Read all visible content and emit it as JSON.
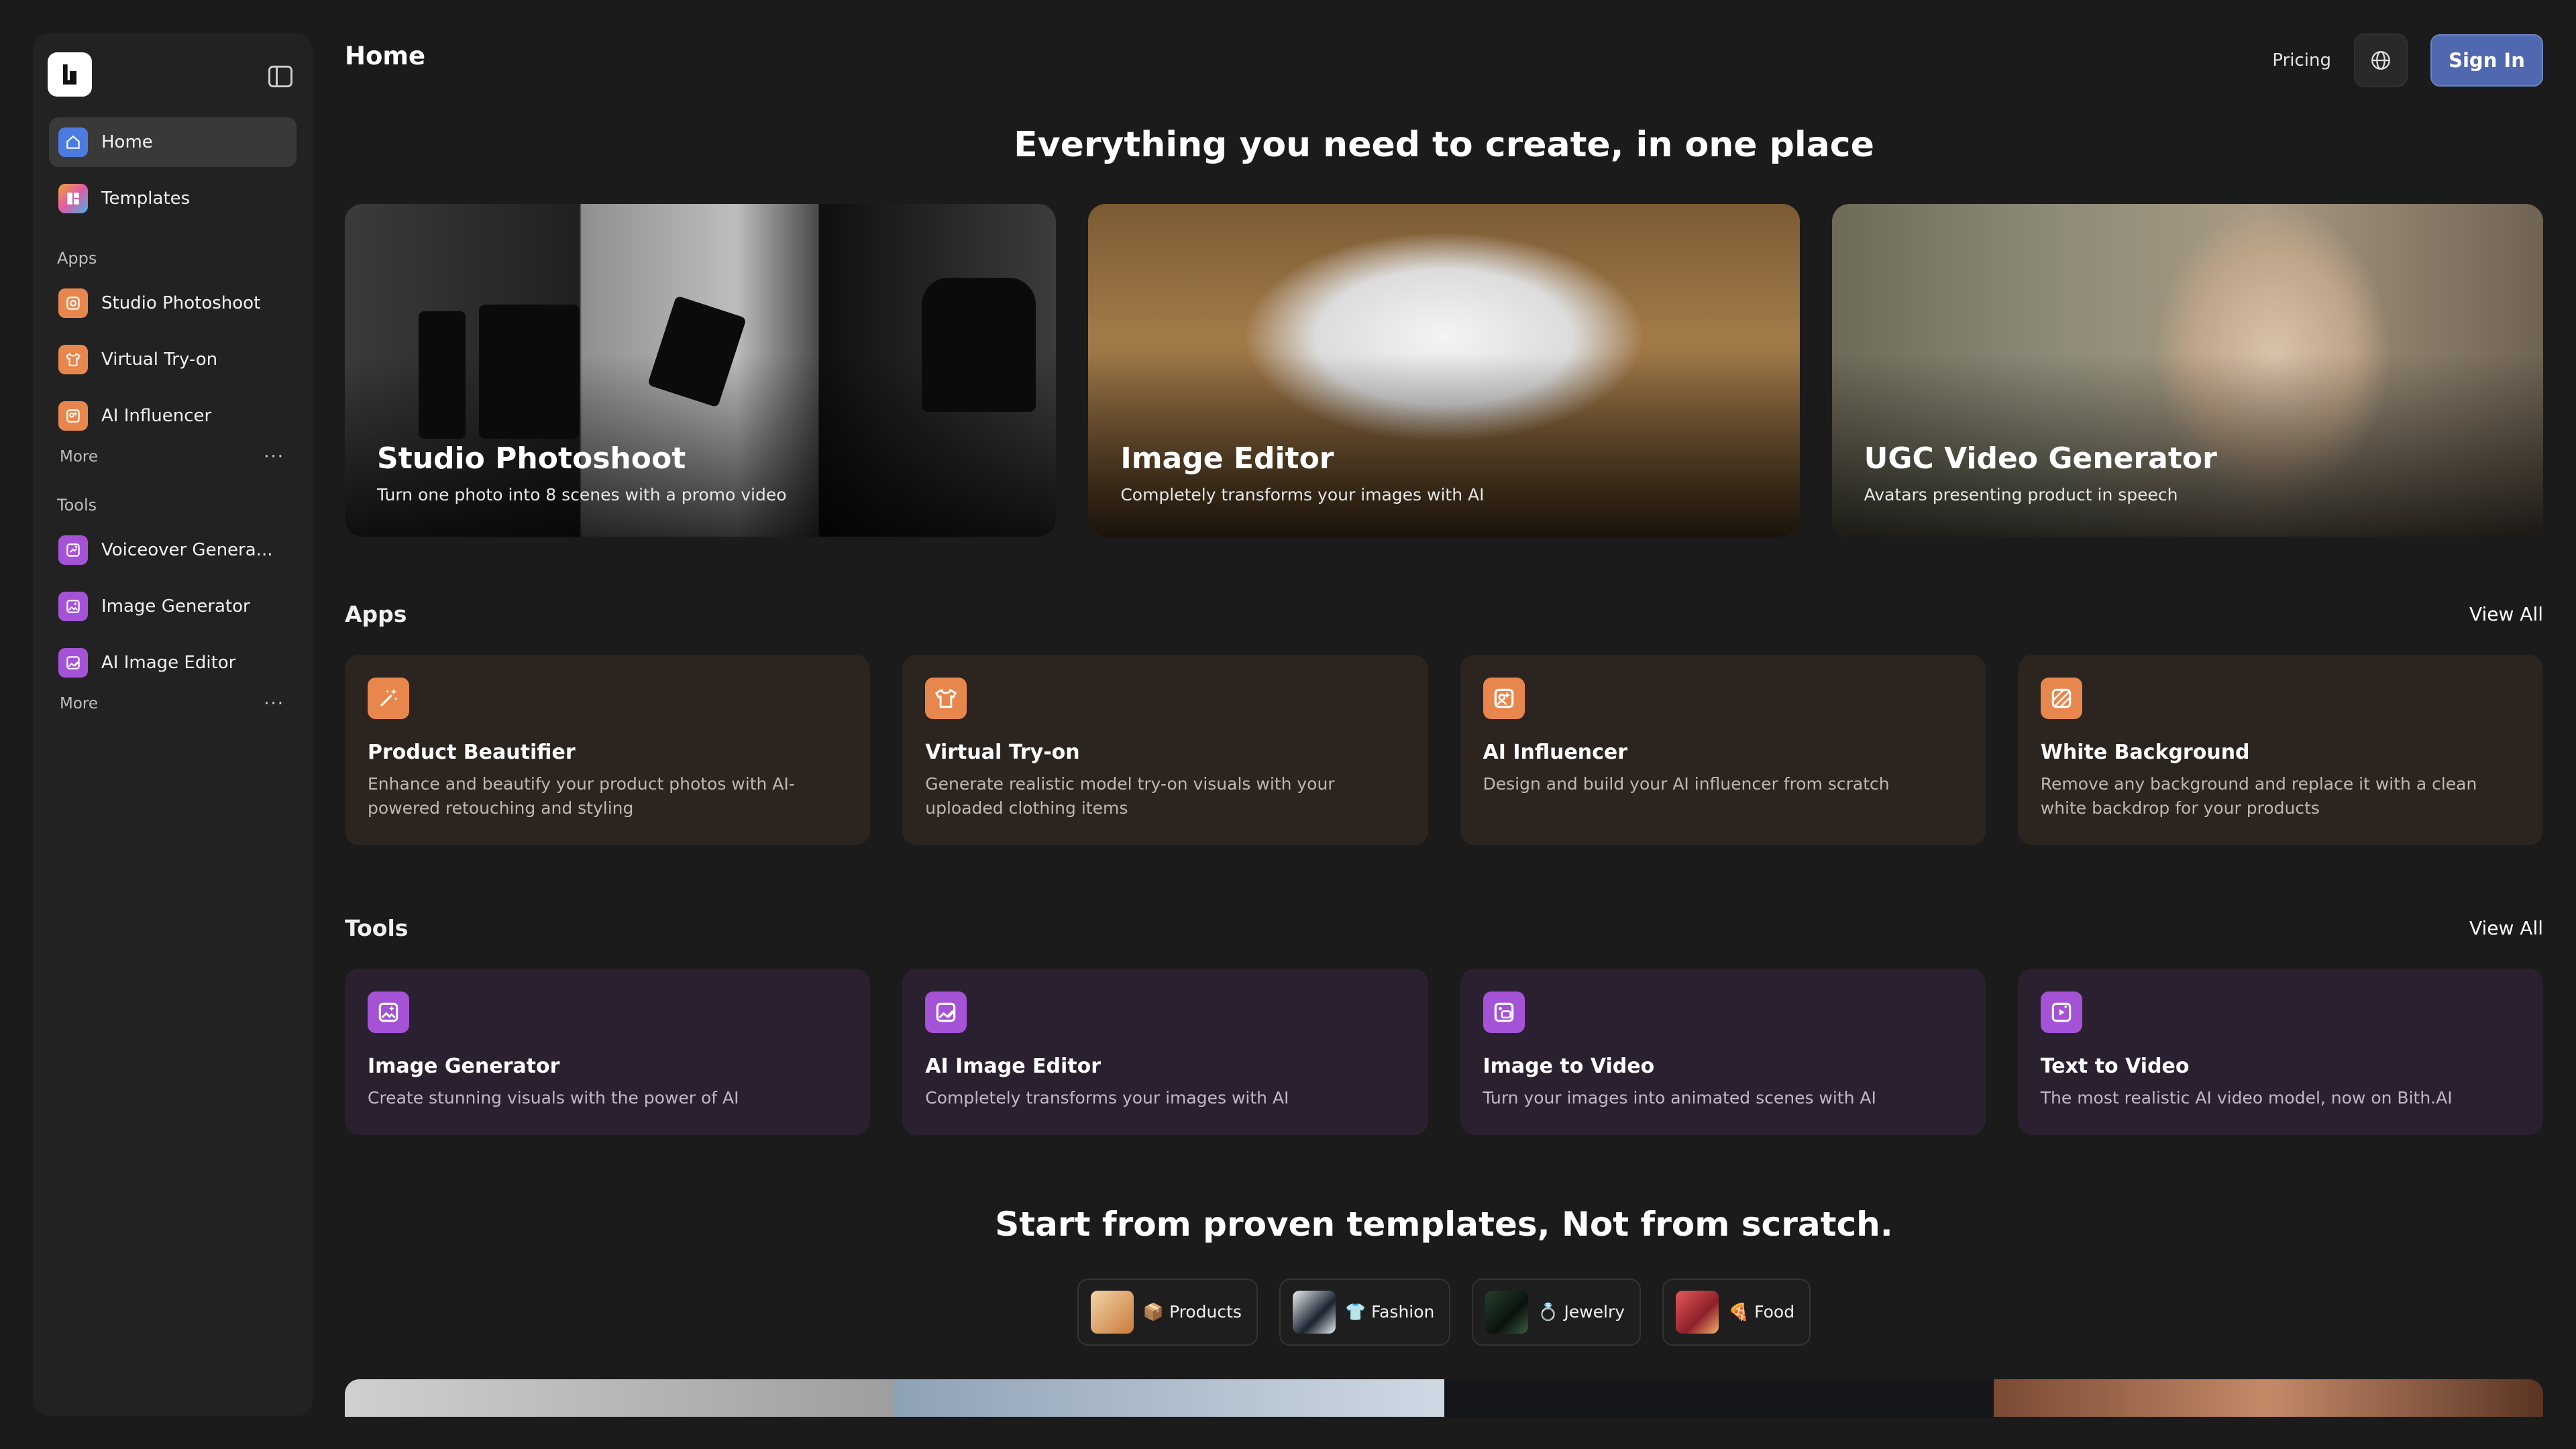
{
  "sidebar": {
    "items": [
      {
        "label": "Home",
        "icon": "home-icon"
      },
      {
        "label": "Templates",
        "icon": "templates-icon"
      }
    ],
    "apps_label": "Apps",
    "apps": [
      {
        "label": "Studio Photoshoot",
        "icon": "camera-icon"
      },
      {
        "label": "Virtual Try-on",
        "icon": "shirt-icon"
      },
      {
        "label": "AI Influencer",
        "icon": "influencer-icon"
      }
    ],
    "apps_more": "More",
    "tools_label": "Tools",
    "tools": [
      {
        "label": "Voiceover Genera...",
        "icon": "voiceover-icon"
      },
      {
        "label": "Image Generator",
        "icon": "image-sparkle-icon"
      },
      {
        "label": "AI Image Editor",
        "icon": "image-edit-icon"
      }
    ],
    "tools_more": "More",
    "more_dots": "···"
  },
  "header": {
    "title": "Home",
    "pricing": "Pricing",
    "signin": "Sign In"
  },
  "hero": {
    "heading": "Everything you need to create, in one place",
    "cards": [
      {
        "title": "Studio Photoshoot",
        "subtitle": "Turn one photo into 8 scenes with a promo video"
      },
      {
        "title": "Image Editor",
        "subtitle": "Completely transforms your images with AI"
      },
      {
        "title": "UGC Video Generator",
        "subtitle": "Avatars presenting product in speech"
      }
    ]
  },
  "apps": {
    "title": "Apps",
    "view_all": "View All",
    "cards": [
      {
        "title": "Product Beautifier",
        "desc": "Enhance and beautify your product photos with AI-powered retouching and styling",
        "icon": "magic-wand-icon"
      },
      {
        "title": "Virtual Try-on",
        "desc": "Generate realistic model try-on visuals with your uploaded clothing items",
        "icon": "shirt-icon"
      },
      {
        "title": "AI Influencer",
        "desc": "Design and build your AI influencer from scratch",
        "icon": "influencer-icon"
      },
      {
        "title": "White Background",
        "desc": "Remove any background and replace it with a clean white backdrop for your products",
        "icon": "background-icon"
      }
    ]
  },
  "tools": {
    "title": "Tools",
    "view_all": "View All",
    "cards": [
      {
        "title": "Image Generator",
        "desc": "Create stunning visuals with the power of AI",
        "icon": "image-sparkle-icon"
      },
      {
        "title": "AI Image Editor",
        "desc": "Completely transforms your images with AI",
        "icon": "image-edit-icon"
      },
      {
        "title": "Image to Video",
        "desc": "Turn your images into animated scenes with AI",
        "icon": "image-video-icon"
      },
      {
        "title": "Text to Video",
        "desc": "The most realistic AI video model, now on Bith.AI",
        "icon": "text-video-icon"
      }
    ]
  },
  "templates": {
    "heading": "Start from proven templates, Not from scratch.",
    "chips": [
      {
        "label": "📦 Products"
      },
      {
        "label": "👕 Fashion"
      },
      {
        "label": "💍 Jewelry"
      },
      {
        "label": "🍕 Food"
      }
    ]
  },
  "colors": {
    "background": "#1c1b1b",
    "sidebar": "#232222",
    "accent": "#5068b0",
    "app_card": "#2b241f",
    "tool_card": "#2b2030",
    "app_icon": "#e8874d",
    "tool_icon": "#a553d6"
  }
}
